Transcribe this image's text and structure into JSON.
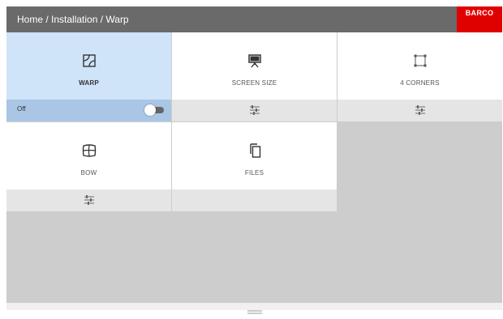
{
  "header": {
    "breadcrumb": "Home / Installation / Warp",
    "logo_text": "BARCO",
    "logo_color": "#e10000"
  },
  "tiles": [
    {
      "label": "WARP",
      "icon": "warp-icon",
      "active": true
    },
    {
      "label": "SCREEN SIZE",
      "icon": "screen-icon",
      "active": false
    },
    {
      "label": "4 CORNERS",
      "icon": "corners-icon",
      "active": false
    },
    {
      "label": "BOW",
      "icon": "bow-icon",
      "active": false
    },
    {
      "label": "FILES",
      "icon": "files-icon",
      "active": false
    }
  ],
  "warp_toggle": {
    "label": "Off",
    "state": "off"
  },
  "colors": {
    "active_tile": "#cfe3f9",
    "active_bar": "#a9c6e4",
    "header": "#6a6a6a",
    "background": "#cdcdcd"
  }
}
